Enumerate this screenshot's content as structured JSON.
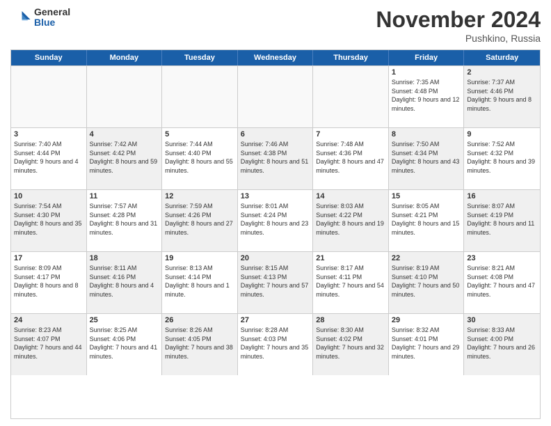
{
  "logo": {
    "general": "General",
    "blue": "Blue"
  },
  "title": "November 2024",
  "location": "Pushkino, Russia",
  "header": {
    "days": [
      "Sunday",
      "Monday",
      "Tuesday",
      "Wednesday",
      "Thursday",
      "Friday",
      "Saturday"
    ]
  },
  "weeks": [
    {
      "cells": [
        {
          "day": "",
          "empty": true
        },
        {
          "day": "",
          "empty": true
        },
        {
          "day": "",
          "empty": true
        },
        {
          "day": "",
          "empty": true
        },
        {
          "day": "",
          "empty": true
        },
        {
          "day": "1",
          "sunrise": "Sunrise: 7:35 AM",
          "sunset": "Sunset: 4:48 PM",
          "daylight": "Daylight: 9 hours and 12 minutes."
        },
        {
          "day": "2",
          "sunrise": "Sunrise: 7:37 AM",
          "sunset": "Sunset: 4:46 PM",
          "daylight": "Daylight: 9 hours and 8 minutes.",
          "shaded": true
        }
      ]
    },
    {
      "cells": [
        {
          "day": "3",
          "sunrise": "Sunrise: 7:40 AM",
          "sunset": "Sunset: 4:44 PM",
          "daylight": "Daylight: 9 hours and 4 minutes."
        },
        {
          "day": "4",
          "sunrise": "Sunrise: 7:42 AM",
          "sunset": "Sunset: 4:42 PM",
          "daylight": "Daylight: 8 hours and 59 minutes.",
          "shaded": true
        },
        {
          "day": "5",
          "sunrise": "Sunrise: 7:44 AM",
          "sunset": "Sunset: 4:40 PM",
          "daylight": "Daylight: 8 hours and 55 minutes."
        },
        {
          "day": "6",
          "sunrise": "Sunrise: 7:46 AM",
          "sunset": "Sunset: 4:38 PM",
          "daylight": "Daylight: 8 hours and 51 minutes.",
          "shaded": true
        },
        {
          "day": "7",
          "sunrise": "Sunrise: 7:48 AM",
          "sunset": "Sunset: 4:36 PM",
          "daylight": "Daylight: 8 hours and 47 minutes."
        },
        {
          "day": "8",
          "sunrise": "Sunrise: 7:50 AM",
          "sunset": "Sunset: 4:34 PM",
          "daylight": "Daylight: 8 hours and 43 minutes.",
          "shaded": true
        },
        {
          "day": "9",
          "sunrise": "Sunrise: 7:52 AM",
          "sunset": "Sunset: 4:32 PM",
          "daylight": "Daylight: 8 hours and 39 minutes."
        }
      ]
    },
    {
      "cells": [
        {
          "day": "10",
          "sunrise": "Sunrise: 7:54 AM",
          "sunset": "Sunset: 4:30 PM",
          "daylight": "Daylight: 8 hours and 35 minutes.",
          "shaded": true
        },
        {
          "day": "11",
          "sunrise": "Sunrise: 7:57 AM",
          "sunset": "Sunset: 4:28 PM",
          "daylight": "Daylight: 8 hours and 31 minutes."
        },
        {
          "day": "12",
          "sunrise": "Sunrise: 7:59 AM",
          "sunset": "Sunset: 4:26 PM",
          "daylight": "Daylight: 8 hours and 27 minutes.",
          "shaded": true
        },
        {
          "day": "13",
          "sunrise": "Sunrise: 8:01 AM",
          "sunset": "Sunset: 4:24 PM",
          "daylight": "Daylight: 8 hours and 23 minutes."
        },
        {
          "day": "14",
          "sunrise": "Sunrise: 8:03 AM",
          "sunset": "Sunset: 4:22 PM",
          "daylight": "Daylight: 8 hours and 19 minutes.",
          "shaded": true
        },
        {
          "day": "15",
          "sunrise": "Sunrise: 8:05 AM",
          "sunset": "Sunset: 4:21 PM",
          "daylight": "Daylight: 8 hours and 15 minutes."
        },
        {
          "day": "16",
          "sunrise": "Sunrise: 8:07 AM",
          "sunset": "Sunset: 4:19 PM",
          "daylight": "Daylight: 8 hours and 11 minutes.",
          "shaded": true
        }
      ]
    },
    {
      "cells": [
        {
          "day": "17",
          "sunrise": "Sunrise: 8:09 AM",
          "sunset": "Sunset: 4:17 PM",
          "daylight": "Daylight: 8 hours and 8 minutes."
        },
        {
          "day": "18",
          "sunrise": "Sunrise: 8:11 AM",
          "sunset": "Sunset: 4:16 PM",
          "daylight": "Daylight: 8 hours and 4 minutes.",
          "shaded": true
        },
        {
          "day": "19",
          "sunrise": "Sunrise: 8:13 AM",
          "sunset": "Sunset: 4:14 PM",
          "daylight": "Daylight: 8 hours and 1 minute."
        },
        {
          "day": "20",
          "sunrise": "Sunrise: 8:15 AM",
          "sunset": "Sunset: 4:13 PM",
          "daylight": "Daylight: 7 hours and 57 minutes.",
          "shaded": true
        },
        {
          "day": "21",
          "sunrise": "Sunrise: 8:17 AM",
          "sunset": "Sunset: 4:11 PM",
          "daylight": "Daylight: 7 hours and 54 minutes."
        },
        {
          "day": "22",
          "sunrise": "Sunrise: 8:19 AM",
          "sunset": "Sunset: 4:10 PM",
          "daylight": "Daylight: 7 hours and 50 minutes.",
          "shaded": true
        },
        {
          "day": "23",
          "sunrise": "Sunrise: 8:21 AM",
          "sunset": "Sunset: 4:08 PM",
          "daylight": "Daylight: 7 hours and 47 minutes."
        }
      ]
    },
    {
      "cells": [
        {
          "day": "24",
          "sunrise": "Sunrise: 8:23 AM",
          "sunset": "Sunset: 4:07 PM",
          "daylight": "Daylight: 7 hours and 44 minutes.",
          "shaded": true
        },
        {
          "day": "25",
          "sunrise": "Sunrise: 8:25 AM",
          "sunset": "Sunset: 4:06 PM",
          "daylight": "Daylight: 7 hours and 41 minutes."
        },
        {
          "day": "26",
          "sunrise": "Sunrise: 8:26 AM",
          "sunset": "Sunset: 4:05 PM",
          "daylight": "Daylight: 7 hours and 38 minutes.",
          "shaded": true
        },
        {
          "day": "27",
          "sunrise": "Sunrise: 8:28 AM",
          "sunset": "Sunset: 4:03 PM",
          "daylight": "Daylight: 7 hours and 35 minutes."
        },
        {
          "day": "28",
          "sunrise": "Sunrise: 8:30 AM",
          "sunset": "Sunset: 4:02 PM",
          "daylight": "Daylight: 7 hours and 32 minutes.",
          "shaded": true
        },
        {
          "day": "29",
          "sunrise": "Sunrise: 8:32 AM",
          "sunset": "Sunset: 4:01 PM",
          "daylight": "Daylight: 7 hours and 29 minutes."
        },
        {
          "day": "30",
          "sunrise": "Sunrise: 8:33 AM",
          "sunset": "Sunset: 4:00 PM",
          "daylight": "Daylight: 7 hours and 26 minutes.",
          "shaded": true
        }
      ]
    }
  ]
}
